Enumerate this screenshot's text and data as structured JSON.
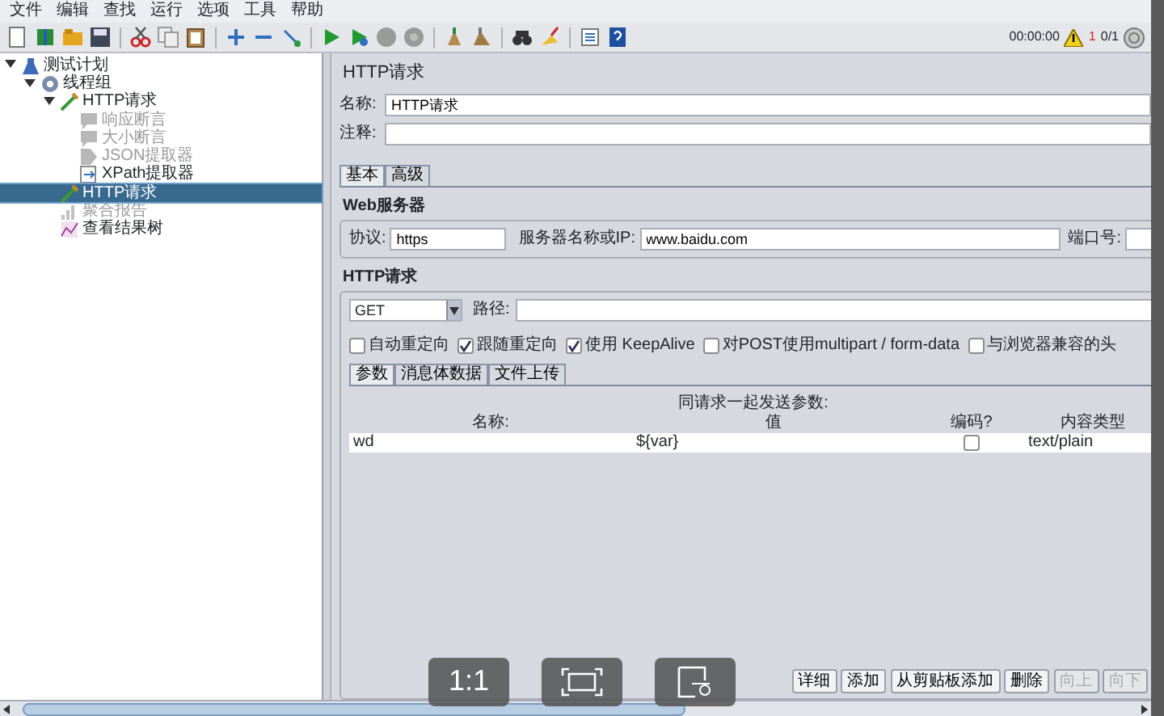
{
  "menu": [
    "文件",
    "编辑",
    "查找",
    "运行",
    "选项",
    "工具",
    "帮助"
  ],
  "status": {
    "timer": "00:00:00",
    "warnings": "1",
    "threads": "0/1"
  },
  "tree": [
    {
      "label": "测试计划",
      "kind": "plan",
      "expanded": true,
      "selected": false,
      "disabled": false,
      "children": [
        {
          "label": "线程组",
          "kind": "threads",
          "expanded": true,
          "selected": false,
          "disabled": false,
          "children": [
            {
              "label": "HTTP请求",
              "kind": "sampler",
              "expanded": true,
              "selected": false,
              "disabled": false,
              "children": [
                {
                  "label": "响应断言",
                  "kind": "assertion",
                  "selected": false,
                  "disabled": true
                },
                {
                  "label": "大小断言",
                  "kind": "assertion",
                  "selected": false,
                  "disabled": true
                },
                {
                  "label": "JSON提取器",
                  "kind": "extractor",
                  "selected": false,
                  "disabled": true
                },
                {
                  "label": "XPath提取器",
                  "kind": "xpath",
                  "selected": false,
                  "disabled": false
                }
              ]
            },
            {
              "label": "HTTP请求",
              "kind": "sampler",
              "selected": true,
              "disabled": false
            },
            {
              "label": "聚合报告",
              "kind": "report",
              "selected": false,
              "disabled": true
            },
            {
              "label": "查看结果树",
              "kind": "results",
              "selected": false,
              "disabled": false
            }
          ]
        }
      ]
    }
  ],
  "panel": {
    "title": "HTTP请求",
    "name_label": "名称:",
    "name_value": "HTTP请求",
    "comment_label": "注释:",
    "tabs": [
      {
        "label": "基本",
        "selected": true
      },
      {
        "label": "高级",
        "selected": false
      }
    ],
    "web_server": {
      "title": "Web服务器",
      "protocol_label": "协议:",
      "protocol": "https",
      "server_label": "服务器名称或IP:",
      "server": "www.baidu.com",
      "port_label": "端口号:"
    },
    "http_request": {
      "title": "HTTP请求",
      "method": "GET",
      "path_label": "路径:",
      "options": [
        {
          "label": "自动重定向",
          "checked": false
        },
        {
          "label": "跟随重定向",
          "checked": true
        },
        {
          "label": "使用 KeepAlive",
          "checked": true
        },
        {
          "label": "对POST使用multipart / form-data",
          "checked": false
        },
        {
          "label": "与浏览器兼容的头",
          "checked": false
        }
      ],
      "tabs": [
        {
          "label": "参数",
          "selected": true
        },
        {
          "label": "消息体数据",
          "selected": false
        },
        {
          "label": "文件上传",
          "selected": false
        }
      ],
      "params": {
        "caption": "同请求一起发送参数:",
        "columns": [
          "名称:",
          "值",
          "编码?",
          "内容类型"
        ],
        "rows": [
          {
            "name": "wd",
            "value": "${var}",
            "encode": false,
            "content_type": "text/plain"
          }
        ]
      },
      "buttons": [
        {
          "label": "详细",
          "disabled": false
        },
        {
          "label": "添加",
          "disabled": false
        },
        {
          "label": "从剪贴板添加",
          "disabled": false
        },
        {
          "label": "删除",
          "disabled": false
        },
        {
          "label": "向上",
          "disabled": true
        },
        {
          "label": "向下",
          "disabled": true
        }
      ]
    }
  },
  "viewer": {
    "zoom_label": "1:1"
  }
}
